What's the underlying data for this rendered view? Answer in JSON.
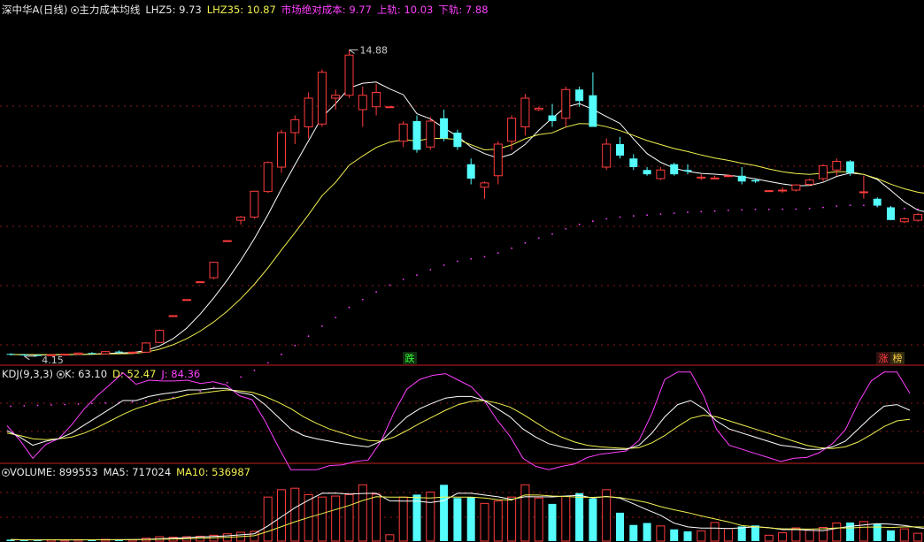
{
  "colors": {
    "background": "#000000",
    "up": "#ff3c3c",
    "down": "#54fcfc",
    "white_line": "#ffffff",
    "yellow_line": "#f0f050",
    "magenta_line": "#ff40ff",
    "grid": "#8a1a1a",
    "separator": "#a01818"
  },
  "header": {
    "stock": "深中华A(日线)",
    "indicator": "主力成本均线",
    "lhz5_label": "LHZ5: ",
    "lhz5_value": "9.73",
    "lhz35_label": "LHZ35: ",
    "lhz35_value": "10.87",
    "abs_label": "市场绝对成本: ",
    "abs_value": "9.77",
    "upper_label": "上轨: ",
    "upper_value": "10.03",
    "lower_label": "下轨: ",
    "lower_value": "7.88"
  },
  "kdj_header": {
    "title": "KDJ(9,3,3)",
    "k_label": "K: ",
    "k_value": "63.10",
    "d_label": "D: ",
    "d_value": "52.47",
    "j_label": "J: ",
    "j_value": "84.36"
  },
  "volume_header": {
    "title": "VOLUME: ",
    "value": "899553",
    "ma5_label": "MA5: ",
    "ma5_value": "717024",
    "ma10_label": "MA10: ",
    "ma10_value": "536987"
  },
  "annotations": {
    "high": "14.88",
    "low": "4.15",
    "drop_badge": "跌",
    "rise_badge": "涨",
    "list_badge": "榜"
  },
  "chart_data": [
    {
      "type": "candlestick",
      "ylim": [
        4.0,
        16.0
      ],
      "ohlc": [
        [
          4.3,
          4.32,
          4.25,
          4.28
        ],
        [
          4.28,
          4.3,
          4.24,
          4.26
        ],
        [
          4.26,
          4.28,
          4.22,
          4.25
        ],
        [
          4.25,
          4.28,
          4.22,
          4.27
        ],
        [
          4.27,
          4.3,
          4.24,
          4.29
        ],
        [
          4.29,
          4.35,
          4.26,
          4.33
        ],
        [
          4.33,
          4.36,
          4.28,
          4.3
        ],
        [
          4.3,
          4.4,
          4.28,
          4.38
        ],
        [
          4.38,
          4.42,
          4.32,
          4.35
        ],
        [
          4.35,
          4.38,
          4.3,
          4.36
        ],
        [
          4.36,
          4.7,
          4.34,
          4.68
        ],
        [
          4.7,
          5.15,
          4.68,
          5.12
        ],
        [
          5.63,
          5.63,
          5.63,
          5.63
        ],
        [
          6.19,
          6.19,
          6.19,
          6.19
        ],
        [
          6.81,
          6.81,
          6.81,
          6.81
        ],
        [
          6.95,
          7.5,
          6.9,
          7.49
        ],
        [
          8.24,
          8.24,
          8.24,
          8.24
        ],
        [
          8.95,
          9.1,
          8.8,
          9.06
        ],
        [
          9.06,
          9.98,
          9.0,
          9.96
        ],
        [
          9.95,
          11.0,
          9.9,
          10.96
        ],
        [
          10.8,
          12.1,
          10.6,
          12.0
        ],
        [
          12.0,
          12.6,
          11.6,
          12.45
        ],
        [
          12.2,
          13.4,
          11.8,
          13.2
        ],
        [
          12.3,
          14.2,
          12.2,
          14.1
        ],
        [
          13.2,
          13.5,
          12.8,
          13.3
        ],
        [
          13.3,
          14.88,
          13.2,
          14.7
        ],
        [
          12.8,
          13.6,
          12.2,
          13.3
        ],
        [
          12.9,
          13.7,
          12.6,
          13.4
        ],
        [
          12.9,
          12.9,
          12.9,
          12.9
        ],
        [
          11.7,
          12.4,
          11.5,
          12.3
        ],
        [
          12.4,
          12.6,
          11.3,
          11.4
        ],
        [
          11.5,
          12.55,
          11.4,
          12.4
        ],
        [
          12.5,
          12.8,
          11.7,
          11.8
        ],
        [
          12.0,
          12.1,
          11.4,
          11.5
        ],
        [
          10.9,
          11.1,
          10.2,
          10.4
        ],
        [
          10.1,
          10.3,
          9.7,
          10.25
        ],
        [
          10.5,
          11.7,
          10.2,
          11.6
        ],
        [
          11.7,
          12.6,
          11.4,
          12.5
        ],
        [
          12.2,
          13.35,
          11.9,
          13.2
        ],
        [
          12.8,
          12.9,
          12.75,
          12.85
        ],
        [
          12.6,
          13.0,
          12.2,
          12.4
        ],
        [
          12.5,
          13.6,
          12.2,
          13.5
        ],
        [
          13.5,
          13.6,
          12.9,
          13.1
        ],
        [
          13.3,
          14.1,
          12.9,
          12.2
        ],
        [
          10.8,
          11.8,
          10.7,
          11.6
        ],
        [
          11.6,
          11.85,
          11.1,
          11.2
        ],
        [
          11.1,
          11.25,
          10.7,
          10.8
        ],
        [
          10.7,
          10.8,
          10.5,
          10.55
        ],
        [
          10.4,
          10.8,
          10.35,
          10.7
        ],
        [
          10.9,
          10.95,
          10.5,
          10.55
        ],
        [
          10.7,
          10.9,
          10.55,
          10.65
        ],
        [
          10.45,
          10.55,
          10.35,
          10.45
        ],
        [
          10.42,
          10.5,
          10.38,
          10.42
        ],
        [
          10.5,
          10.55,
          10.45,
          10.5
        ],
        [
          10.5,
          10.8,
          10.2,
          10.3
        ],
        [
          10.35,
          10.4,
          10.25,
          10.3
        ],
        [
          9.95,
          10.0,
          9.95,
          9.98
        ],
        [
          9.97,
          10.1,
          9.9,
          10.0
        ],
        [
          10.0,
          10.2,
          9.95,
          10.18
        ],
        [
          10.2,
          10.4,
          10.15,
          10.35
        ],
        [
          10.4,
          10.9,
          10.3,
          10.85
        ],
        [
          10.7,
          11.1,
          10.5,
          11.0
        ],
        [
          11.0,
          11.05,
          10.5,
          10.6
        ],
        [
          9.94,
          10.5,
          9.7,
          9.94
        ],
        [
          9.7,
          9.75,
          9.4,
          9.46
        ],
        [
          9.4,
          9.45,
          8.95,
          8.96
        ],
        [
          8.9,
          9.05,
          8.85,
          9.0
        ],
        [
          8.95,
          9.2,
          8.9,
          9.15
        ],
        [
          9.3,
          9.45,
          9.25,
          9.4
        ],
        [
          9.4,
          9.8,
          9.2,
          9.33
        ],
        [
          9.4,
          9.55,
          9.3,
          9.36
        ],
        [
          9.2,
          9.45,
          9.15,
          9.4
        ],
        [
          9.1,
          9.45,
          9.05,
          9.4
        ],
        [
          9.2,
          9.65,
          9.15,
          9.55
        ],
        [
          9.6,
          10.7,
          9.55,
          10.55
        ],
        [
          11.2,
          11.5,
          10.45,
          10.55
        ],
        [
          10.6,
          11.05,
          10.2,
          10.95
        ]
      ],
      "low_point": "4.15",
      "high_point": "14.88"
    },
    {
      "type": "line",
      "title": "KDJ(9,3,3)",
      "ylim": [
        0,
        100
      ],
      "series": [
        {
          "name": "K",
          "values": [
            38,
            30,
            20,
            25,
            28,
            35,
            45,
            55,
            65,
            75,
            75,
            80,
            83,
            85,
            88,
            88,
            90,
            90,
            85,
            82,
            70,
            55,
            40,
            32,
            28,
            25,
            22,
            20,
            18,
            25,
            40,
            55,
            65,
            72,
            78,
            80,
            80,
            75,
            65,
            55,
            40,
            30,
            22,
            18,
            15,
            15,
            15,
            15,
            15,
            20,
            35,
            55,
            70,
            75,
            65,
            50,
            40,
            35,
            30,
            25,
            20,
            18,
            15,
            15,
            18,
            25,
            40,
            55,
            68,
            70,
            63
          ]
        },
        {
          "name": "D",
          "values": [
            35,
            32,
            28,
            27,
            28,
            30,
            35,
            42,
            50,
            58,
            65,
            70,
            75,
            78,
            82,
            84,
            86,
            88,
            87,
            85,
            80,
            73,
            65,
            55,
            47,
            40,
            35,
            30,
            26,
            25,
            30,
            38,
            47,
            55,
            63,
            70,
            74,
            75,
            72,
            67,
            58,
            48,
            38,
            30,
            24,
            20,
            18,
            17,
            16,
            17,
            23,
            32,
            43,
            53,
            57,
            55,
            50,
            45,
            40,
            35,
            30,
            25,
            20,
            17,
            16,
            18,
            24,
            33,
            43,
            50,
            52
          ]
        },
        {
          "name": "J",
          "values": [
            44,
            26,
            4,
            21,
            28,
            45,
            65,
            81,
            95,
            109,
            95,
            100,
            99,
            99,
            100,
            96,
            98,
            94,
            81,
            76,
            50,
            19,
            -10,
            -14,
            -10,
            -5,
            -4,
            0,
            2,
            25,
            60,
            89,
            101,
            106,
            108,
            100,
            92,
            75,
            51,
            31,
            4,
            -6,
            -10,
            -6,
            -3,
            5,
            9,
            11,
            13,
            26,
            59,
            101,
            124,
            119,
            81,
            40,
            20,
            15,
            10,
            5,
            0,
            4,
            5,
            11,
            22,
            39,
            72,
            99,
            118,
            110,
            84
          ]
        }
      ],
      "k": "63.10",
      "d": "52.47",
      "j": "84.36"
    },
    {
      "type": "bar",
      "title": "VOLUME",
      "ylim": [
        0,
        1300000
      ],
      "values": [
        30000,
        25000,
        22000,
        28000,
        25000,
        30000,
        28000,
        35000,
        30000,
        28000,
        60000,
        90000,
        80000,
        90000,
        100000,
        120000,
        150000,
        180000,
        200000,
        900000,
        1050000,
        1080000,
        950000,
        900000,
        920000,
        950000,
        1150000,
        960000,
        130000,
        900000,
        950000,
        1000000,
        1150000,
        880000,
        900000,
        770000,
        820000,
        900000,
        1150000,
        880000,
        760000,
        910000,
        980000,
        870000,
        1050000,
        580000,
        330000,
        370000,
        310000,
        240000,
        200000,
        210000,
        380000,
        260000,
        300000,
        320000,
        120000,
        170000,
        270000,
        220000,
        280000,
        370000,
        380000,
        400000,
        350000,
        220000,
        250000,
        160000,
        220000,
        260000,
        260000,
        180000,
        210000,
        200000,
        320000,
        1000000,
        480000
      ],
      "ma5": "717024",
      "ma10": "536987"
    }
  ]
}
